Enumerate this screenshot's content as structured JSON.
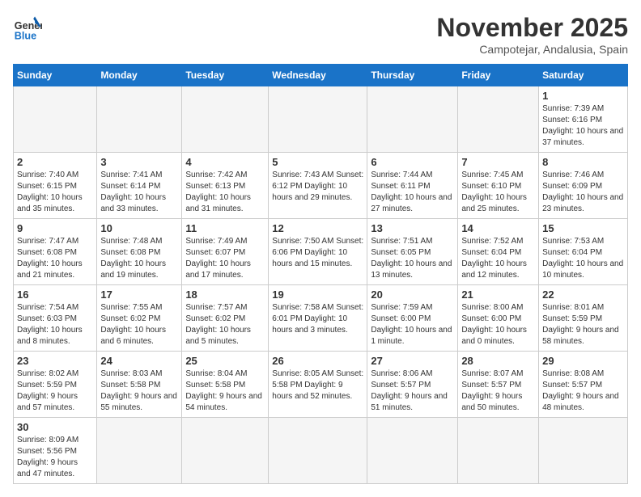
{
  "header": {
    "logo_general": "General",
    "logo_blue": "Blue",
    "month_title": "November 2025",
    "subtitle": "Campotejar, Andalusia, Spain"
  },
  "weekdays": [
    "Sunday",
    "Monday",
    "Tuesday",
    "Wednesday",
    "Thursday",
    "Friday",
    "Saturday"
  ],
  "weeks": [
    [
      {
        "day": "",
        "info": ""
      },
      {
        "day": "",
        "info": ""
      },
      {
        "day": "",
        "info": ""
      },
      {
        "day": "",
        "info": ""
      },
      {
        "day": "",
        "info": ""
      },
      {
        "day": "",
        "info": ""
      },
      {
        "day": "1",
        "info": "Sunrise: 7:39 AM\nSunset: 6:16 PM\nDaylight: 10 hours and 37 minutes."
      }
    ],
    [
      {
        "day": "2",
        "info": "Sunrise: 7:40 AM\nSunset: 6:15 PM\nDaylight: 10 hours and 35 minutes."
      },
      {
        "day": "3",
        "info": "Sunrise: 7:41 AM\nSunset: 6:14 PM\nDaylight: 10 hours and 33 minutes."
      },
      {
        "day": "4",
        "info": "Sunrise: 7:42 AM\nSunset: 6:13 PM\nDaylight: 10 hours and 31 minutes."
      },
      {
        "day": "5",
        "info": "Sunrise: 7:43 AM\nSunset: 6:12 PM\nDaylight: 10 hours and 29 minutes."
      },
      {
        "day": "6",
        "info": "Sunrise: 7:44 AM\nSunset: 6:11 PM\nDaylight: 10 hours and 27 minutes."
      },
      {
        "day": "7",
        "info": "Sunrise: 7:45 AM\nSunset: 6:10 PM\nDaylight: 10 hours and 25 minutes."
      },
      {
        "day": "8",
        "info": "Sunrise: 7:46 AM\nSunset: 6:09 PM\nDaylight: 10 hours and 23 minutes."
      }
    ],
    [
      {
        "day": "9",
        "info": "Sunrise: 7:47 AM\nSunset: 6:08 PM\nDaylight: 10 hours and 21 minutes."
      },
      {
        "day": "10",
        "info": "Sunrise: 7:48 AM\nSunset: 6:08 PM\nDaylight: 10 hours and 19 minutes."
      },
      {
        "day": "11",
        "info": "Sunrise: 7:49 AM\nSunset: 6:07 PM\nDaylight: 10 hours and 17 minutes."
      },
      {
        "day": "12",
        "info": "Sunrise: 7:50 AM\nSunset: 6:06 PM\nDaylight: 10 hours and 15 minutes."
      },
      {
        "day": "13",
        "info": "Sunrise: 7:51 AM\nSunset: 6:05 PM\nDaylight: 10 hours and 13 minutes."
      },
      {
        "day": "14",
        "info": "Sunrise: 7:52 AM\nSunset: 6:04 PM\nDaylight: 10 hours and 12 minutes."
      },
      {
        "day": "15",
        "info": "Sunrise: 7:53 AM\nSunset: 6:04 PM\nDaylight: 10 hours and 10 minutes."
      }
    ],
    [
      {
        "day": "16",
        "info": "Sunrise: 7:54 AM\nSunset: 6:03 PM\nDaylight: 10 hours and 8 minutes."
      },
      {
        "day": "17",
        "info": "Sunrise: 7:55 AM\nSunset: 6:02 PM\nDaylight: 10 hours and 6 minutes."
      },
      {
        "day": "18",
        "info": "Sunrise: 7:57 AM\nSunset: 6:02 PM\nDaylight: 10 hours and 5 minutes."
      },
      {
        "day": "19",
        "info": "Sunrise: 7:58 AM\nSunset: 6:01 PM\nDaylight: 10 hours and 3 minutes."
      },
      {
        "day": "20",
        "info": "Sunrise: 7:59 AM\nSunset: 6:00 PM\nDaylight: 10 hours and 1 minute."
      },
      {
        "day": "21",
        "info": "Sunrise: 8:00 AM\nSunset: 6:00 PM\nDaylight: 10 hours and 0 minutes."
      },
      {
        "day": "22",
        "info": "Sunrise: 8:01 AM\nSunset: 5:59 PM\nDaylight: 9 hours and 58 minutes."
      }
    ],
    [
      {
        "day": "23",
        "info": "Sunrise: 8:02 AM\nSunset: 5:59 PM\nDaylight: 9 hours and 57 minutes."
      },
      {
        "day": "24",
        "info": "Sunrise: 8:03 AM\nSunset: 5:58 PM\nDaylight: 9 hours and 55 minutes."
      },
      {
        "day": "25",
        "info": "Sunrise: 8:04 AM\nSunset: 5:58 PM\nDaylight: 9 hours and 54 minutes."
      },
      {
        "day": "26",
        "info": "Sunrise: 8:05 AM\nSunset: 5:58 PM\nDaylight: 9 hours and 52 minutes."
      },
      {
        "day": "27",
        "info": "Sunrise: 8:06 AM\nSunset: 5:57 PM\nDaylight: 9 hours and 51 minutes."
      },
      {
        "day": "28",
        "info": "Sunrise: 8:07 AM\nSunset: 5:57 PM\nDaylight: 9 hours and 50 minutes."
      },
      {
        "day": "29",
        "info": "Sunrise: 8:08 AM\nSunset: 5:57 PM\nDaylight: 9 hours and 48 minutes."
      }
    ],
    [
      {
        "day": "30",
        "info": "Sunrise: 8:09 AM\nSunset: 5:56 PM\nDaylight: 9 hours and 47 minutes."
      },
      {
        "day": "",
        "info": ""
      },
      {
        "day": "",
        "info": ""
      },
      {
        "day": "",
        "info": ""
      },
      {
        "day": "",
        "info": ""
      },
      {
        "day": "",
        "info": ""
      },
      {
        "day": "",
        "info": ""
      }
    ]
  ]
}
